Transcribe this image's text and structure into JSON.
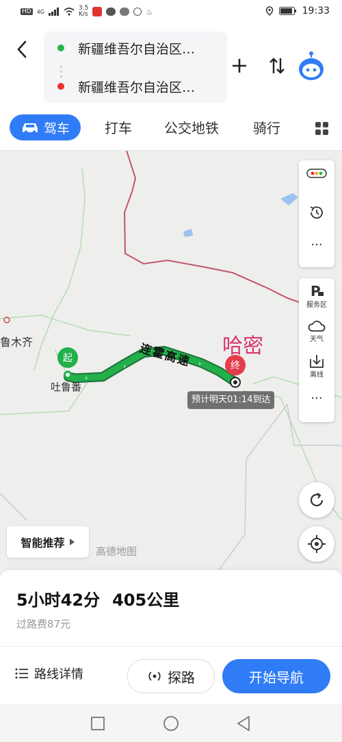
{
  "status_bar": {
    "network_speed": "3.5\nK/s",
    "time": "19:33",
    "hd_label": "HD",
    "signal_label": "4G"
  },
  "header": {
    "origin": "新疆维吾尔自治区…",
    "destination": "新疆维吾尔自治区…",
    "colors": {
      "origin_dot": "#27b44a",
      "destination_dot": "#e8322c",
      "accent": "#2f7cf6"
    }
  },
  "tabs": [
    {
      "label": "驾车",
      "active": true
    },
    {
      "label": "打车",
      "active": false
    },
    {
      "label": "公交地铁",
      "active": false
    },
    {
      "label": "骑行",
      "active": false
    }
  ],
  "map": {
    "city_urumqi": "鲁木齐",
    "city_turpan": "吐鲁番",
    "city_hami": "哈密",
    "start_label": "起",
    "end_label": "终",
    "highway_name": "连霍高速",
    "eta_text": "预计明天01:14到达",
    "watermark": "高德地图",
    "side_controls": {
      "service_area": "服务区",
      "weather": "天气",
      "offline": "离线",
      "more": "···"
    },
    "smart_recommend": "智能推荐"
  },
  "route_summary": {
    "duration": "5小时42分",
    "distance": "405公里",
    "toll": "过路费87元"
  },
  "actions": {
    "route_detail": "路线详情",
    "explore": "探路",
    "start_navigation": "开始导航"
  }
}
